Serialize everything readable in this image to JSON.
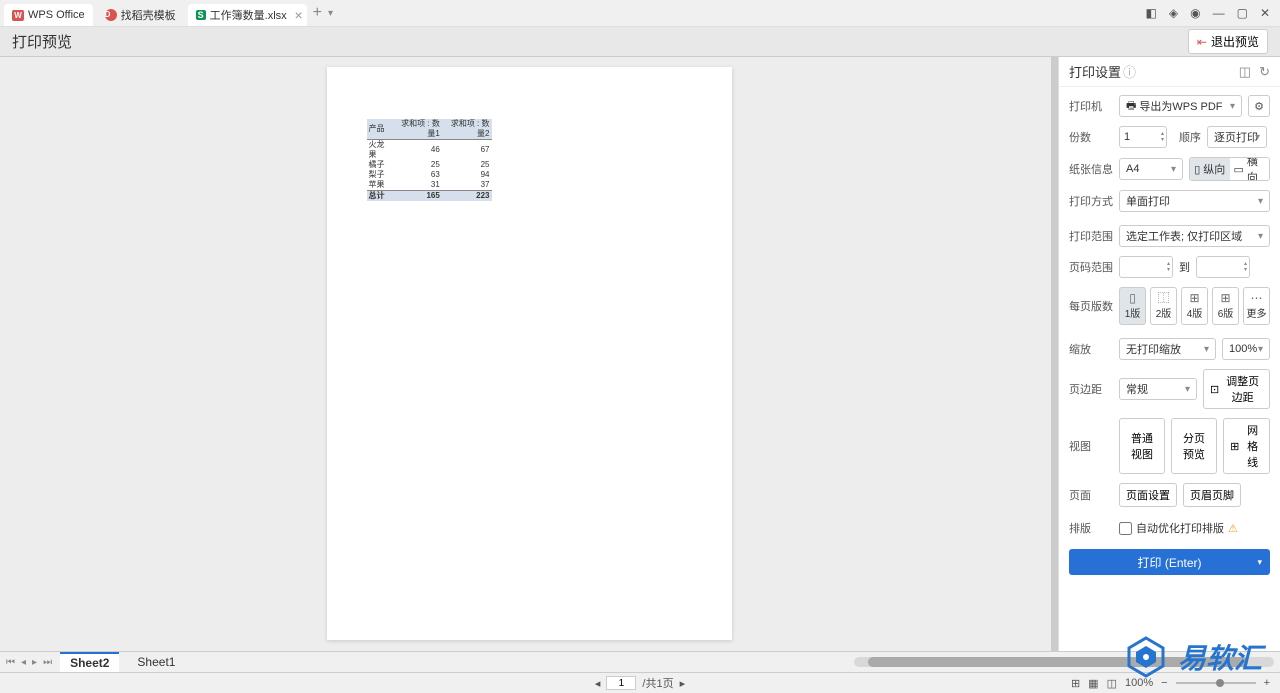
{
  "titlebar": {
    "app_tab": "WPS Office",
    "template_tab": "找稻壳模板",
    "file_tab": "工作簿数量.xlsx",
    "add_label": "+"
  },
  "toolbar": {
    "title": "打印预览",
    "exit_preview": "退出预览"
  },
  "pivot": {
    "headers": [
      "产品",
      "求和项 : 数量1",
      "求和项 : 数量2"
    ],
    "rows": [
      {
        "label": "火龙果",
        "q1": 46,
        "q2": 67
      },
      {
        "label": "橘子",
        "q1": 25,
        "q2": 25
      },
      {
        "label": "梨子",
        "q1": 63,
        "q2": 94
      },
      {
        "label": "苹果",
        "q1": 31,
        "q2": 37
      }
    ],
    "total": {
      "label": "总计",
      "q1": 165,
      "q2": 223
    }
  },
  "settings": {
    "title": "打印设置",
    "printer_label": "打印机",
    "printer_value": "导出为WPS PDF",
    "copies_label": "份数",
    "copies_value": "1",
    "order_label": "顺序",
    "order_value": "逐页打印",
    "paper_label": "纸张信息",
    "paper_value": "A4",
    "orient_portrait": "纵向",
    "orient_landscape": "横向",
    "duplex_label": "打印方式",
    "duplex_value": "单面打印",
    "range_label": "打印范围",
    "range_value": "选定工作表; 仅打印区域",
    "page_range_label": "页码范围",
    "page_range_to": "到",
    "pps_label": "每页版数",
    "pps_options": [
      "1版",
      "2版",
      "4版",
      "6版",
      "更多"
    ],
    "scale_label": "缩放",
    "scale_value": "无打印缩放",
    "scale_percent": "100%",
    "margins_label": "页边距",
    "margins_value": "常规",
    "margins_adjust": "调整页边距",
    "view_label": "视图",
    "view_normal": "普通视图",
    "view_pagebreak": "分页预览",
    "view_grid": "网格线",
    "page_label": "页面",
    "page_setup": "页面设置",
    "page_hf": "页眉页脚",
    "layout_label": "排版",
    "layout_auto": "自动优化打印排版",
    "print_button": "打印 (Enter)"
  },
  "sheets": {
    "active": "Sheet2",
    "other": "Sheet1"
  },
  "statusbar": {
    "page_current": "1",
    "page_total": "/共1页",
    "zoom": "100%"
  },
  "watermark": {
    "text": "易软汇"
  }
}
